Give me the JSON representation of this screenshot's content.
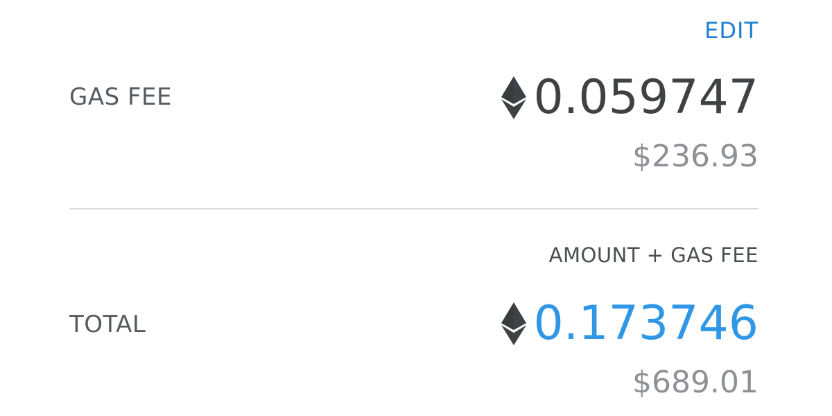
{
  "edit": {
    "label": "EDIT",
    "color": "#1f7fd1"
  },
  "gas_fee": {
    "label": "GAS FEE",
    "currency_icon": "ethereum-icon",
    "amount": "0.059747",
    "fiat": "$236.93"
  },
  "total": {
    "sublabel": "AMOUNT + GAS FEE",
    "label": "TOTAL",
    "currency_icon": "ethereum-icon",
    "amount": "0.173746",
    "amount_color": "#2f97e6",
    "fiat": "$689.01"
  }
}
